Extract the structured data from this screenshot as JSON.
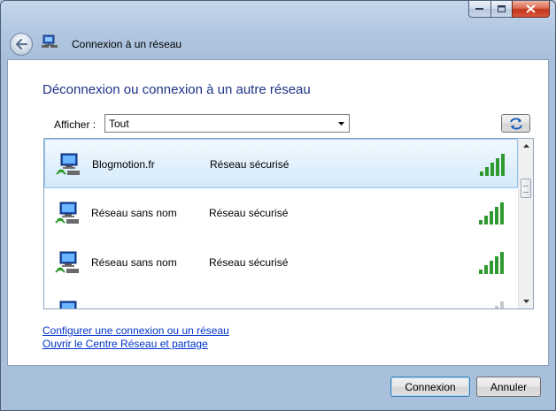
{
  "window": {
    "title": "Connexion à un réseau"
  },
  "content": {
    "heading": "Déconnexion ou connexion à un autre réseau",
    "filter": {
      "label": "Afficher :",
      "selected": "Tout"
    },
    "networks": [
      {
        "name": "Blogmotion.fr",
        "security": "Réseau sécurisé",
        "signal_bars": 5,
        "selected": true
      },
      {
        "name": "Réseau sans nom",
        "security": "Réseau sécurisé",
        "signal_bars": 5,
        "selected": false
      },
      {
        "name": "Réseau sans nom",
        "security": "Réseau sécurisé",
        "signal_bars": 5,
        "selected": false
      }
    ],
    "links": {
      "setup": "Configurer une connexion ou un réseau",
      "center": "Ouvrir le Centre Réseau et partage"
    }
  },
  "buttons": {
    "connect": "Connexion",
    "cancel": "Annuler"
  },
  "colors": {
    "heading": "#1e3287",
    "link": "#0033cc",
    "signal": "#2f9a2f",
    "selection": "#d4eafb"
  },
  "icons": {
    "back": "back-arrow-icon",
    "network": "network-computer-icon",
    "refresh": "refresh-icon",
    "signal": "signal-strength-icon"
  }
}
